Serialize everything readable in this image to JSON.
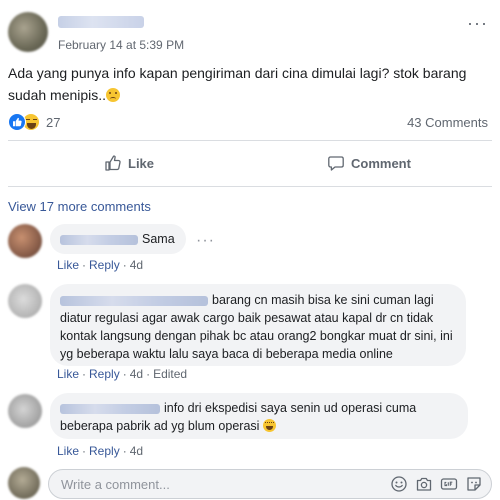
{
  "post": {
    "timestamp": "February 14 at 5:39 PM",
    "text": "Ada yang punya info kapan pengiriman dari cina dimulai lagi? stok barang sudah menipis..",
    "reaction_count": "27",
    "comment_count": "43 Comments"
  },
  "actions": {
    "like": "Like",
    "comment": "Comment"
  },
  "view_more": "View 17 more comments",
  "comments": [
    {
      "text": "Sama",
      "like": "Like",
      "reply": "Reply",
      "time": "4d",
      "edited": ""
    },
    {
      "text": "barang cn masih bisa ke sini cuman lagi diatur regulasi agar awak cargo baik pesawat atau kapal dr cn tidak kontak langsung dengan pihak bc atau orang2 bongkar muat dr sini, ini yg beberapa waktu lalu saya baca di beberapa media online",
      "like": "Like",
      "reply": "Reply",
      "time": "4d",
      "edited": "Edited"
    },
    {
      "text": "info dri ekspedisi saya senin ud operasi cuma beberapa pabrik ad yg blum operasi",
      "like": "Like",
      "reply": "Reply",
      "time": "4d",
      "edited": ""
    }
  ],
  "composer": {
    "placeholder": "Write a comment..."
  },
  "colors": {
    "link": "#385898",
    "like_blue": "#1877f2",
    "haha_yellow": "#f7c531",
    "bubble": "#f2f3f5"
  },
  "icons": [
    "more-horizontal-icon",
    "like-reaction-icon",
    "haha-reaction-icon",
    "thumbs-up-icon",
    "comment-icon",
    "sad-emoji-icon",
    "haha-emoji-icon",
    "emoji-icon",
    "camera-icon",
    "gif-icon",
    "sticker-icon"
  ]
}
